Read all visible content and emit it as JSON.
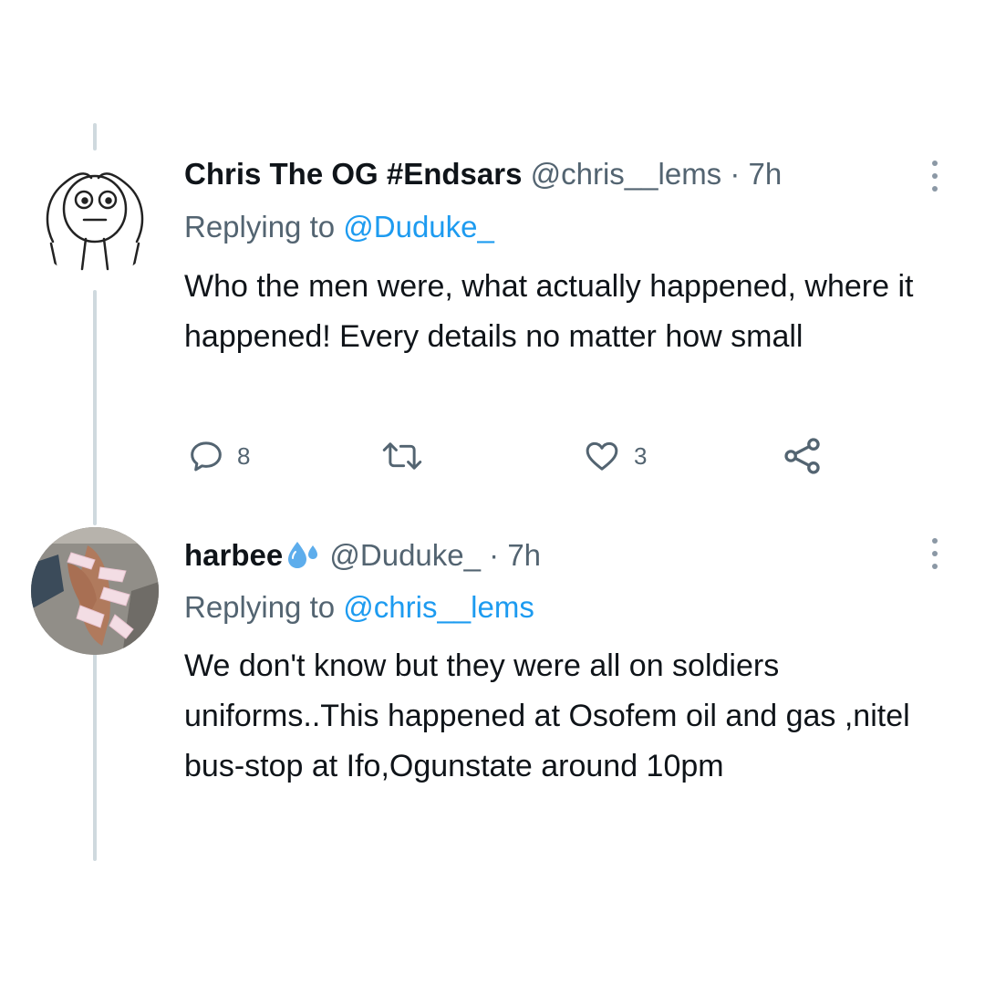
{
  "tweets": [
    {
      "name": "Chris The OG #Endsars",
      "handle": "@chris__lems",
      "separator": " · ",
      "time": "7h",
      "replying_prefix": "Replying to ",
      "replying_to": "@Duduke_",
      "text": "Who the men were, what actually happened, where it happened! Every details no matter how small",
      "actions": {
        "reply_count": "8",
        "retweet_count": "",
        "like_count": "3"
      }
    },
    {
      "name": "harbee",
      "name_emoji": "sweat-droplets-icon",
      "handle": "@Duduke_",
      "separator": " · ",
      "time": "7h",
      "replying_prefix": "Replying to ",
      "replying_to": "@chris__lems",
      "text": "We don't know but they were all on soldiers uniforms..This happened at Osofem oil and gas ,nitel bus-stop at Ifo,Ogunstate  around 10pm"
    }
  ],
  "colors": {
    "accent": "#1d9bf0",
    "secondary_text": "#536471",
    "thread_line": "#cfd9de"
  }
}
